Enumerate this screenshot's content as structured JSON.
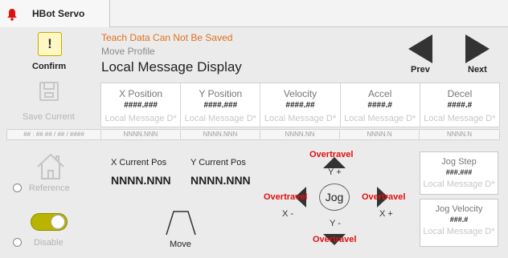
{
  "window": {
    "tab_title": "HBot Servo"
  },
  "sidebar": {
    "confirm_label": "Confirm",
    "save_label": "Save Current",
    "reference_label": "Reference",
    "disable_label": "Disable"
  },
  "header": {
    "warning": "Teach Data Can Not Be Saved",
    "profile": "Move Profile",
    "message_title": "Local Message Display"
  },
  "nav": {
    "prev_label": "Prev",
    "next_label": "Next"
  },
  "grid": {
    "columns": [
      {
        "header": "X Position",
        "value": "####.###",
        "message": "Local Message D*"
      },
      {
        "header": "Y Position",
        "value": "####.###",
        "message": "Local Message D*"
      },
      {
        "header": "Velocity",
        "value": "####.##",
        "message": "Local Message D*"
      },
      {
        "header": "Accel",
        "value": "####.#",
        "message": "Local Message D*"
      },
      {
        "header": "Decel",
        "value": "####.#",
        "message": "Local Message D*"
      }
    ],
    "footer": [
      "## : ## ## / ## / ####",
      "NNNN.NNN",
      "NNNN.NNN",
      "NNNN.NN",
      "NNNN.N",
      "NNNN.N"
    ]
  },
  "current": {
    "x_label": "X Current Pos",
    "y_label": "Y Current Pos",
    "x_value": "NNNN.NNN",
    "y_value": "NNNN.NNN"
  },
  "move": {
    "label": "Move"
  },
  "jog": {
    "center_label": "Jog",
    "overtravel": "Overtravel",
    "y_plus": "Y +",
    "y_minus": "Y -",
    "x_minus": "X -",
    "x_plus": "X +"
  },
  "jog_step": {
    "header": "Jog Step",
    "value": "###.###",
    "message": "Local Message D*"
  },
  "jog_velocity": {
    "header": "Jog Velocity",
    "value": "###.#",
    "message": "Local Message D*"
  },
  "colors": {
    "warning": "#e07020",
    "overtravel": "#e01010",
    "toggle": "#b8b400",
    "bell": "#e01010"
  },
  "toggle_state": "on"
}
